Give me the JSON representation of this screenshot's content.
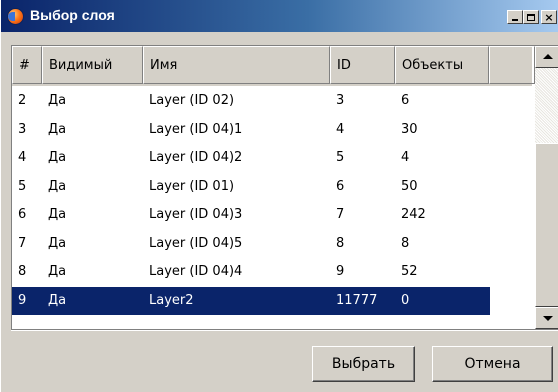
{
  "window": {
    "title": "Выбор слоя",
    "controls": {
      "minimize": "_",
      "maximize": "□",
      "close": "×"
    }
  },
  "table": {
    "columns": [
      "#",
      "Видимый",
      "Имя",
      "ID",
      "Объекты"
    ],
    "rows": [
      {
        "num": "2",
        "visible": "Да",
        "name": "Layer (ID 02)",
        "id": "3",
        "objects": "6"
      },
      {
        "num": "3",
        "visible": "Да",
        "name": "Layer (ID 04)1",
        "id": "4",
        "objects": "30"
      },
      {
        "num": "4",
        "visible": "Да",
        "name": "Layer (ID 04)2",
        "id": "5",
        "objects": "4"
      },
      {
        "num": "5",
        "visible": "Да",
        "name": "Layer (ID 01)",
        "id": "6",
        "objects": "50"
      },
      {
        "num": "6",
        "visible": "Да",
        "name": "Layer (ID 04)3",
        "id": "7",
        "objects": "242"
      },
      {
        "num": "7",
        "visible": "Да",
        "name": "Layer (ID 04)5",
        "id": "8",
        "objects": "8"
      },
      {
        "num": "8",
        "visible": "Да",
        "name": "Layer (ID 04)4",
        "id": "9",
        "objects": "52"
      },
      {
        "num": "9",
        "visible": "Да",
        "name": "Layer2",
        "id": "11777",
        "objects": "0",
        "selected": true
      }
    ]
  },
  "buttons": {
    "select": "Выбрать",
    "cancel": "Отмена"
  },
  "colors": {
    "selection": "#0a246a",
    "face": "#d4d0c8"
  }
}
